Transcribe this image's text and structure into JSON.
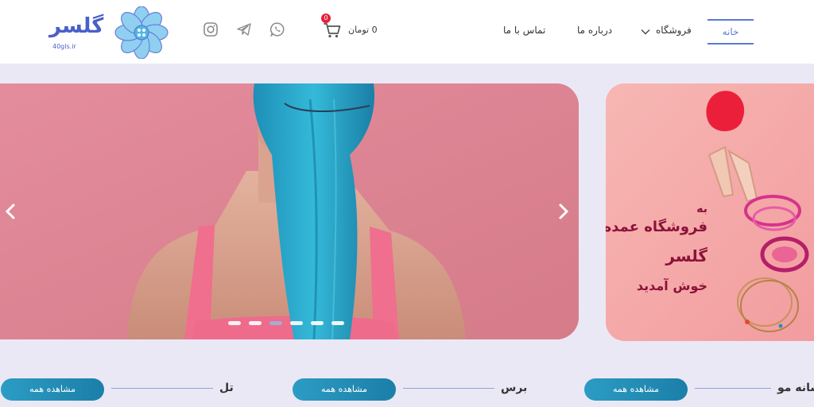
{
  "brand": {
    "name": "گلسر",
    "site": "40gls.ir"
  },
  "nav": {
    "home": "خانه",
    "shop": "فروشگاه",
    "about": "درباره ما",
    "contact": "تماس با ما"
  },
  "cart": {
    "count": "0",
    "price": "0 تومان"
  },
  "social": [
    "instagram-icon",
    "telegram-icon",
    "whatsapp-icon"
  ],
  "slider": {
    "dots": 6,
    "active_dot": 3
  },
  "banner": {
    "line1": "به",
    "line2": "فروشگاه عمده",
    "line3": "گلسر",
    "line4": "خوش آمدید"
  },
  "categories": [
    {
      "title": "شانه مو",
      "button": "مشاهده همه"
    },
    {
      "title": "برس",
      "button": "مشاهده همه"
    },
    {
      "title": "تل",
      "button": "مشاهده همه"
    }
  ],
  "colors": {
    "accent": "#5b7bd3",
    "button": "#1b8ab3",
    "badge": "#e8203a",
    "background": "#ebe8f6"
  }
}
